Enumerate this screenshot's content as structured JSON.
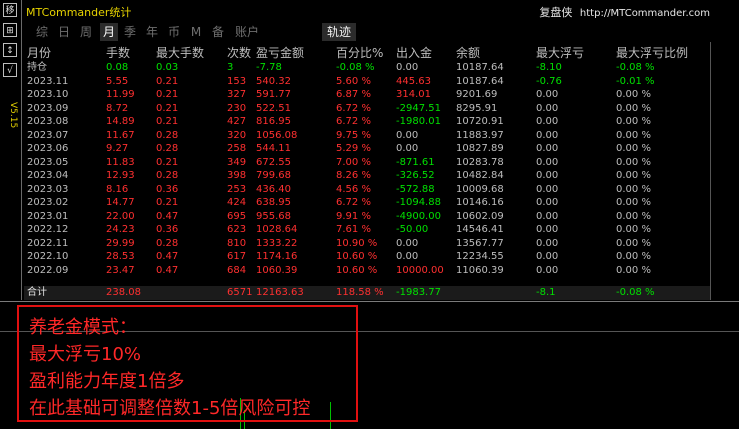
{
  "sidebar": {
    "buttons": [
      "移",
      "⊞",
      "↕",
      "√"
    ],
    "version": "V5.15"
  },
  "header": {
    "title": "MTCommander统计",
    "right_label": "复盘侠",
    "right_url": "http://MTCommander.com"
  },
  "tabs": [
    "综",
    "日",
    "周",
    "月",
    "季",
    "年",
    "币",
    "M",
    "备",
    "账户"
  ],
  "active_tab": "月",
  "track_button": "轨迹",
  "columns": [
    "月份",
    "手数",
    "最大手数",
    "次数",
    "盈亏金额",
    "百分比%",
    "出入金",
    "余额",
    "最大浮亏",
    "最大浮亏比例"
  ],
  "rows": [
    [
      "持仓",
      "0.08",
      "0.03",
      "3",
      "-7.78",
      "-0.08 %",
      "0.00",
      "10187.64",
      "-8.10",
      "-0.08 %"
    ],
    [
      "2023.11",
      "5.55",
      "0.21",
      "153",
      "540.32",
      "5.60 %",
      "445.63",
      "10187.64",
      "-0.76",
      "-0.01 %"
    ],
    [
      "2023.10",
      "11.99",
      "0.21",
      "327",
      "591.77",
      "6.87 %",
      "314.01",
      "9201.69",
      "0.00",
      "0.00 %"
    ],
    [
      "2023.09",
      "8.72",
      "0.21",
      "230",
      "522.51",
      "6.72 %",
      "-2947.51",
      "8295.91",
      "0.00",
      "0.00 %"
    ],
    [
      "2023.08",
      "14.89",
      "0.21",
      "427",
      "816.95",
      "6.72 %",
      "-1980.01",
      "10720.91",
      "0.00",
      "0.00 %"
    ],
    [
      "2023.07",
      "11.67",
      "0.28",
      "320",
      "1056.08",
      "9.75 %",
      "0.00",
      "11883.97",
      "0.00",
      "0.00 %"
    ],
    [
      "2023.06",
      "9.27",
      "0.28",
      "258",
      "544.11",
      "5.29 %",
      "0.00",
      "10827.89",
      "0.00",
      "0.00 %"
    ],
    [
      "2023.05",
      "11.83",
      "0.21",
      "349",
      "672.55",
      "7.00 %",
      "-871.61",
      "10283.78",
      "0.00",
      "0.00 %"
    ],
    [
      "2023.04",
      "12.93",
      "0.28",
      "398",
      "799.68",
      "8.26 %",
      "-326.52",
      "10482.84",
      "0.00",
      "0.00 %"
    ],
    [
      "2023.03",
      "8.16",
      "0.36",
      "253",
      "436.40",
      "4.56 %",
      "-572.88",
      "10009.68",
      "0.00",
      "0.00 %"
    ],
    [
      "2023.02",
      "14.77",
      "0.21",
      "424",
      "638.95",
      "6.72 %",
      "-1094.88",
      "10146.16",
      "0.00",
      "0.00 %"
    ],
    [
      "2023.01",
      "22.00",
      "0.47",
      "695",
      "955.68",
      "9.91 %",
      "-4900.00",
      "10602.09",
      "0.00",
      "0.00 %"
    ],
    [
      "2022.12",
      "24.23",
      "0.36",
      "623",
      "1028.64",
      "7.61 %",
      "-50.00",
      "14546.41",
      "0.00",
      "0.00 %"
    ],
    [
      "2022.11",
      "29.99",
      "0.28",
      "810",
      "1333.22",
      "10.90 %",
      "0.00",
      "13567.77",
      "0.00",
      "0.00 %"
    ],
    [
      "2022.10",
      "28.53",
      "0.47",
      "617",
      "1174.16",
      "10.60 %",
      "0.00",
      "12234.55",
      "0.00",
      "0.00 %"
    ],
    [
      "2022.09",
      "23.47",
      "0.47",
      "684",
      "1060.39",
      "10.60 %",
      "10000.00",
      "11060.39",
      "0.00",
      "0.00 %"
    ]
  ],
  "total": [
    "合计",
    "238.08",
    "",
    "6571",
    "12163.63",
    "118.58 %",
    "-1983.77",
    "",
    "-8.1",
    "-0.08 %"
  ],
  "note": {
    "lines": [
      "养老金模式：",
      "最大浮亏10%",
      "盈利能力年度1倍多",
      "在此基础可调整倍数1-5倍风险可控"
    ]
  },
  "colors": {
    "accent": "#e6d200",
    "positive": "#00e000",
    "negative": "#ff3030",
    "note_border": "#e01010"
  }
}
